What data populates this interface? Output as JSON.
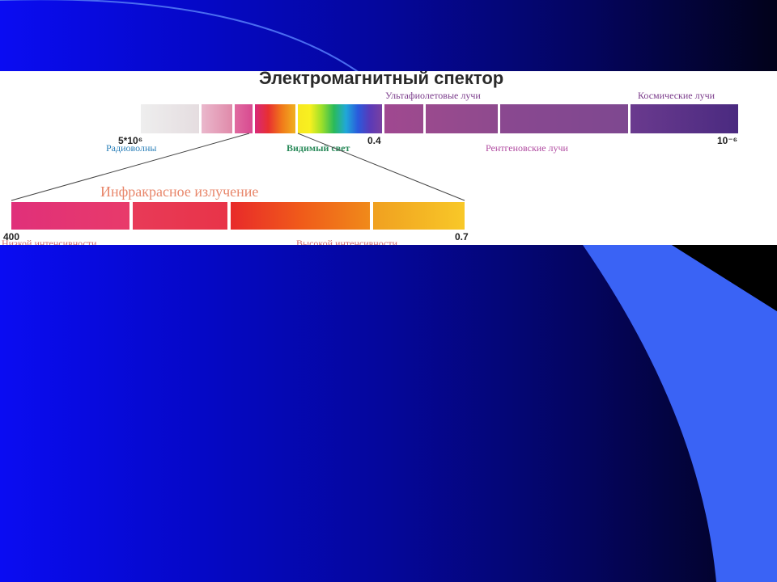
{
  "slide": {
    "background": "#0508c8",
    "accent_light": "#3a63f5"
  },
  "diagram": {
    "title": "Электромагнитный спектор",
    "bands": {
      "ultraviolet": "Ультафиолетовые лучи",
      "cosmic": "Космические лучи",
      "radio": "Радиоволны",
      "visible": "Видимый свет",
      "xray": "Рентгеновские лучи"
    },
    "ticks": {
      "left": "5*10⁶",
      "middle": "0.4",
      "right": "10⁻⁶"
    },
    "infrared": {
      "title": "Инфракрасное излучение",
      "left_value": "400",
      "right_value": "0.7",
      "low_intensity": "Низкой интенсивности",
      "high_intensity": "Высокой интенсивности"
    }
  }
}
